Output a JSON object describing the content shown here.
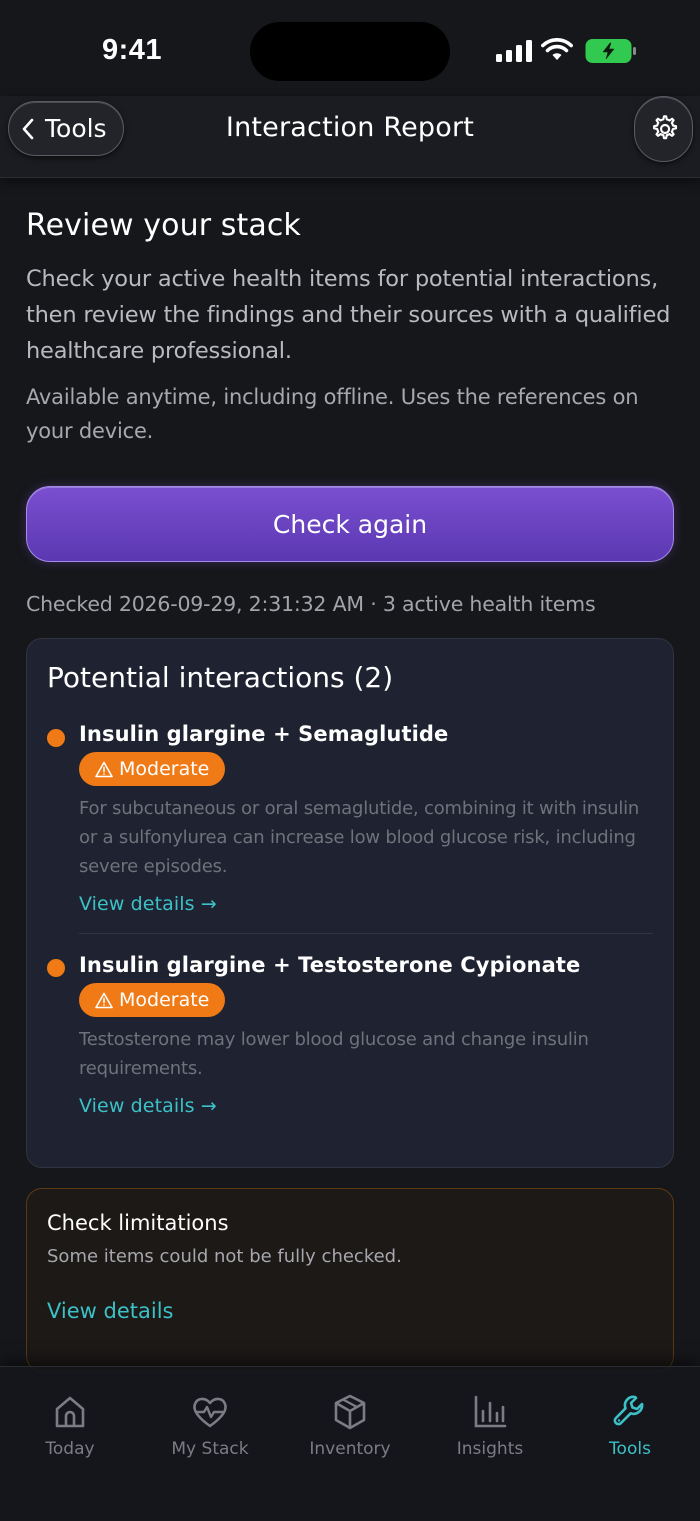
{
  "status_bar": {
    "time": "9:41"
  },
  "header": {
    "back_label": "Tools",
    "title": "Interaction Report"
  },
  "intro": {
    "title": "Review your stack",
    "body": "Check your active health items for potential interactions, then review the findings and their sources with a qualified healthcare professional.",
    "offline_note": "Available anytime, including offline. Uses the references on your device."
  },
  "check_button_label": "Check again",
  "checked_meta": "Checked 2026-09-29, 2:31:32 AM · 3 active health items",
  "interactions": {
    "title": "Potential interactions (2)",
    "items": [
      {
        "pair": "Insulin glargine + Semaglutide",
        "severity": "Moderate",
        "description": "For subcutaneous or oral semaglutide, combining it with insulin or a sulfonylurea can increase low blood glucose risk, including severe episodes.",
        "link": "View details →"
      },
      {
        "pair": "Insulin glargine + Testosterone Cypionate",
        "severity": "Moderate",
        "description": "Testosterone may lower blood glucose and change insulin requirements.",
        "link": "View details →"
      }
    ],
    "severity_color": "#f07a16"
  },
  "limitations": {
    "title": "Check limitations",
    "body": "Some items could not be fully checked.",
    "link": "View details"
  },
  "tabs": [
    {
      "label": "Today",
      "icon": "home-icon",
      "active": false
    },
    {
      "label": "My Stack",
      "icon": "heart-pulse-icon",
      "active": false
    },
    {
      "label": "Inventory",
      "icon": "box-icon",
      "active": false
    },
    {
      "label": "Insights",
      "icon": "bar-chart-icon",
      "active": false
    },
    {
      "label": "Tools",
      "icon": "wrench-icon",
      "active": true
    }
  ],
  "colors": {
    "accent": "#3bc1c7",
    "primary_button": "#6a45c2",
    "background": "#16171b"
  }
}
